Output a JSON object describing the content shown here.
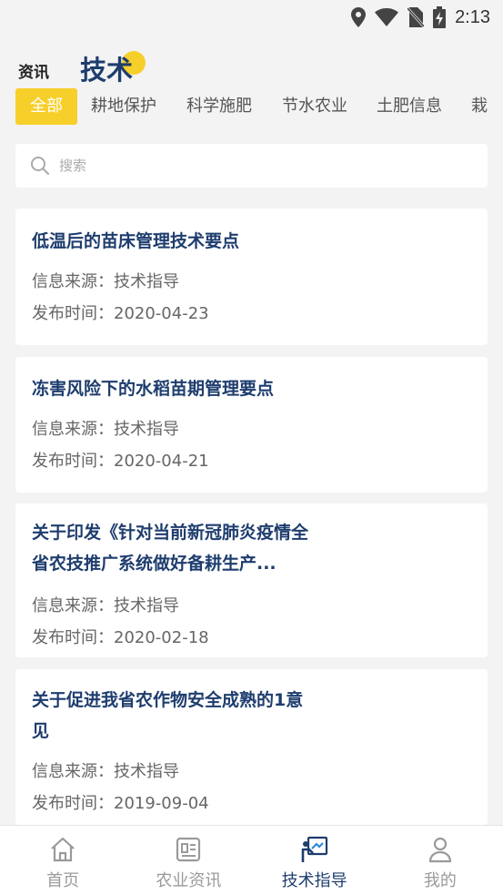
{
  "status_bar": {
    "time": "2:13"
  },
  "header": {
    "tab_news": "资讯",
    "tab_tech": "技术"
  },
  "categories": [
    "全部",
    "耕地保护",
    "科学施肥",
    "节水农业",
    "土肥信息",
    "栽"
  ],
  "search": {
    "placeholder": "搜索"
  },
  "cards": [
    {
      "title": "低温后的苗床管理技术要点",
      "source": "信息来源：技术指导",
      "date": "发布时间：2020-04-23"
    },
    {
      "title": "冻害风险下的水稻苗期管理要点",
      "source": "信息来源：技术指导",
      "date": "发布时间：2020-04-21"
    },
    {
      "title": "关于印发《针对当前新冠肺炎疫情全省农技推广系统做好备耕生产...",
      "source": "信息来源：技术指导",
      "date": "发布时间：2020-02-18"
    },
    {
      "title": "关于促进我省农作物安全成熟的1意见",
      "source": "信息来源：技术指导",
      "date": "发布时间：2019-09-04"
    }
  ],
  "bottom_nav": {
    "home": "首页",
    "news": "农业资讯",
    "tech": "技术指导",
    "mine": "我的"
  },
  "colors": {
    "accent": "#f7cf2a",
    "title": "#1e3d6e"
  }
}
